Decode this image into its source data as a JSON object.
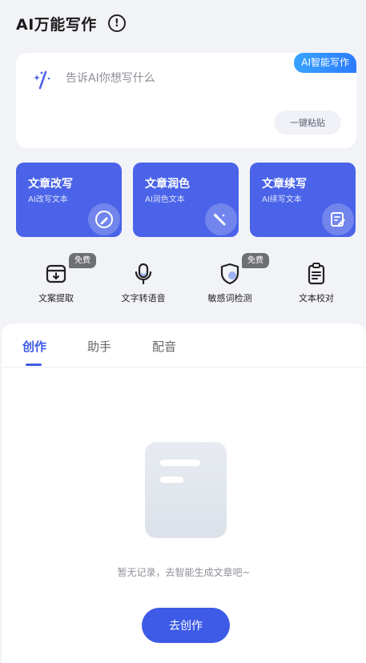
{
  "header": {
    "title": "AI万能写作",
    "info_glyph": "!"
  },
  "prompt": {
    "badge": "AI智能写作",
    "placeholder": "告诉AI你想写什么",
    "paste_label": "一键粘贴"
  },
  "features": [
    {
      "title": "文章改写",
      "subtitle": "AI改写文本",
      "icon": "pen-edit-icon"
    },
    {
      "title": "文章润色",
      "subtitle": "AI润色文本",
      "icon": "magic-wand-icon"
    },
    {
      "title": "文章续写",
      "subtitle": "AI续写文本",
      "icon": "note-edit-icon"
    }
  ],
  "tools": [
    {
      "label": "文案提取",
      "icon": "download-box-icon",
      "free": "免费"
    },
    {
      "label": "文字转语音",
      "icon": "microphone-icon"
    },
    {
      "label": "敏感词检测",
      "icon": "shield-icon",
      "free": "免费"
    },
    {
      "label": "文本校对",
      "icon": "clipboard-icon"
    }
  ],
  "tabs": [
    {
      "label": "创作",
      "active": true
    },
    {
      "label": "助手",
      "active": false
    },
    {
      "label": "配音",
      "active": false
    }
  ],
  "empty": {
    "message": "暂无记录，去智能生成文章吧~",
    "button_label": "去创作"
  },
  "colors": {
    "accent": "#3d5be6",
    "card_blue": "#4a63e8",
    "badge_gradient_start": "#37a4ff",
    "background": "#f2f3f7"
  }
}
